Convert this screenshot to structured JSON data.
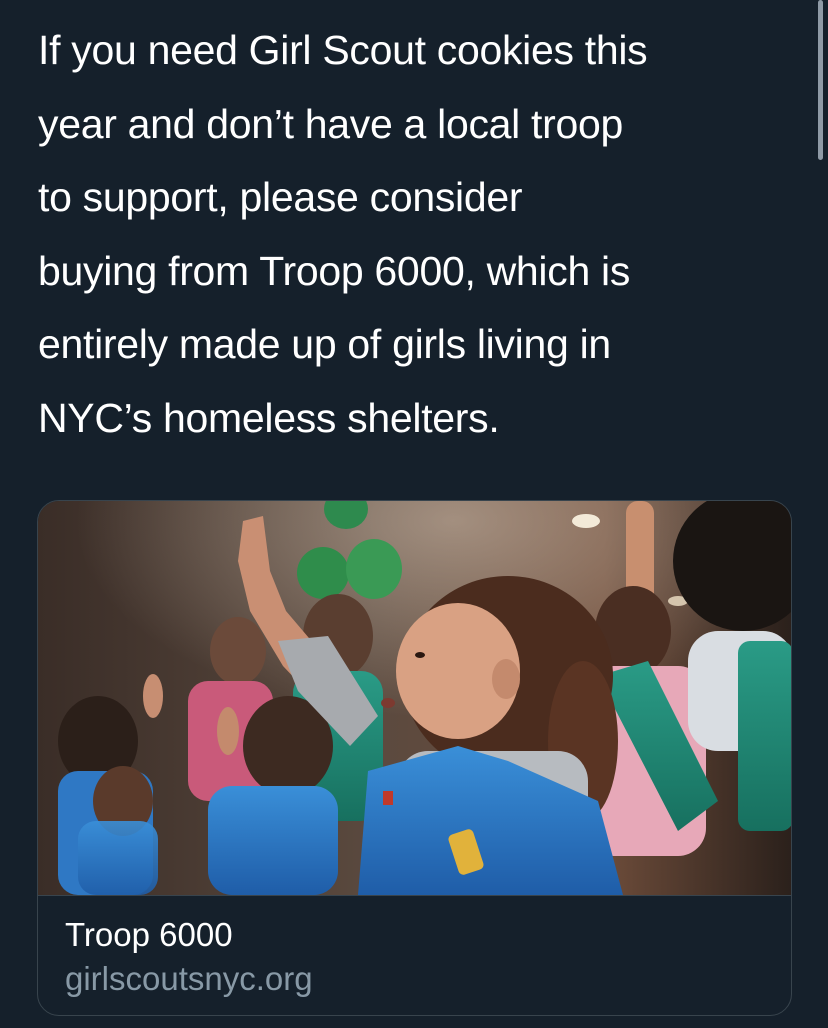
{
  "tweet": {
    "text_lines": [
      "If you need Girl Scout cookies this",
      "year and don’t have a local troop",
      "to support, please consider",
      "buying from Troop 6000, which is",
      "entirely made up of girls living in",
      "NYC’s homeless shelters."
    ]
  },
  "link_card": {
    "image_icon": "photo-girl-scouts-raising-hands",
    "title": "Troop 6000",
    "domain": "girlscoutsnyc.org"
  },
  "colors": {
    "background": "#15202b",
    "text": "#ffffff",
    "secondary_text": "#8899a6",
    "border": "#38444d"
  }
}
